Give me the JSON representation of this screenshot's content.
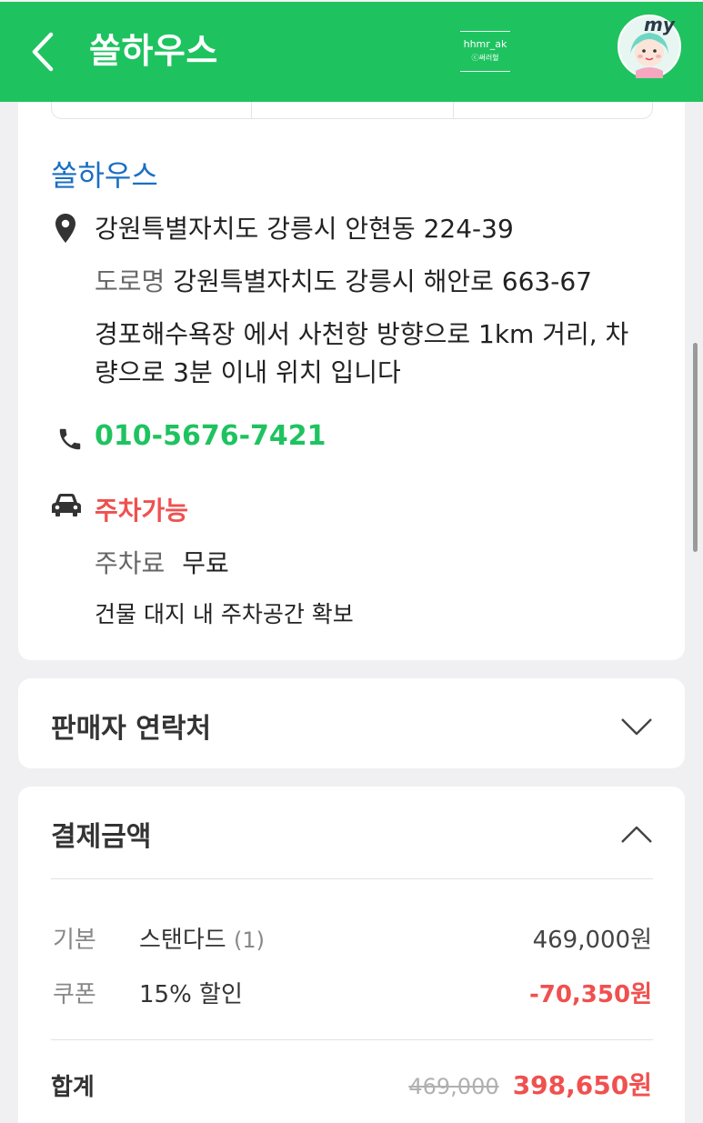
{
  "header": {
    "title": "쏠하우스",
    "watermark_top": "hhmr_ak",
    "watermark_bottom": "ⓒ써러혈",
    "avatar_label": "my",
    "bg_color": "#1ec360"
  },
  "info": {
    "place_name": "쏠하우스",
    "address": "강원특별자치도 강릉시 안현동 224-39",
    "road_label": "도로명",
    "road_address": "강원특별자치도 강릉시 해안로 663-67",
    "directions_line1": "경포해수욕장 에서 사천항 방향으로 1km 거리, 차",
    "directions_line2": "량으로 3분 이내 위치 입니다",
    "phone": "010-5676-7421",
    "parking_status": "주차가능",
    "parking_fee_label": "주차료",
    "parking_fee": "무료",
    "parking_note": "건물 대지 내 주차공간 확보"
  },
  "seller": {
    "title": "판매자 연락처"
  },
  "payment": {
    "title": "결제금액",
    "base_label": "기본",
    "base_item": "스탠다드",
    "base_qty": "(1)",
    "base_price": "469,000원",
    "coupon_label": "쿠폰",
    "coupon_item": "15% 할인",
    "coupon_price": "-70,350원",
    "total_label": "합계",
    "total_original": "469,000",
    "total_final": "398,650원"
  },
  "colors": {
    "accent_green": "#1ec360",
    "link_blue": "#1a6fc2",
    "alert_red": "#f0504f"
  },
  "icons": [
    "back-arrow-icon",
    "map-pin-icon",
    "phone-icon",
    "car-icon",
    "chevron-down-icon",
    "chevron-up-icon"
  ]
}
